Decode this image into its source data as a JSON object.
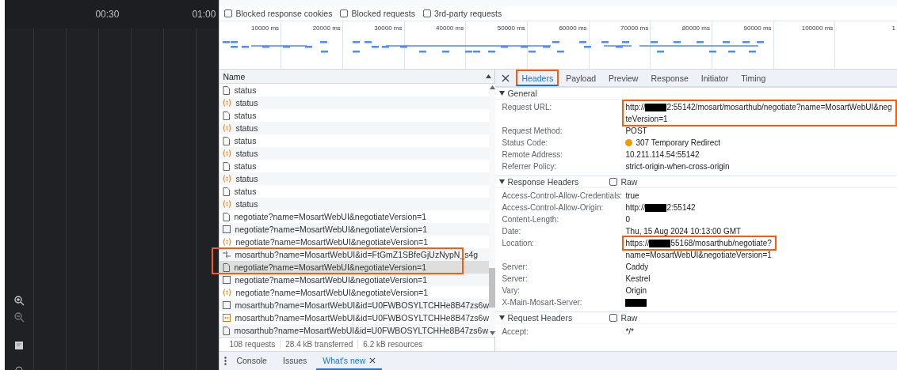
{
  "timeline_panel": {
    "time_labels": [
      "00:30",
      "01:00"
    ]
  },
  "filters": [
    {
      "label": "Blocked response cookies",
      "checked": false
    },
    {
      "label": "Blocked requests",
      "checked": false
    },
    {
      "label": "3rd-party requests",
      "checked": false
    }
  ],
  "overview": {
    "ticks": [
      "10000 ms",
      "20000 ms",
      "30000 ms",
      "40000 ms",
      "50000 ms",
      "60000 ms",
      "70000 ms",
      "80000 ms",
      "90000 ms",
      "100000 ms",
      "1"
    ]
  },
  "requests": {
    "column": "Name",
    "rows": [
      {
        "name": "status",
        "kind": "document",
        "selected": false,
        "highlight": false
      },
      {
        "name": "status",
        "kind": "script",
        "selected": false,
        "highlight": false
      },
      {
        "name": "status",
        "kind": "document",
        "selected": false,
        "highlight": false
      },
      {
        "name": "status",
        "kind": "script",
        "selected": false,
        "highlight": false
      },
      {
        "name": "status",
        "kind": "document",
        "selected": false,
        "highlight": false
      },
      {
        "name": "status",
        "kind": "script",
        "selected": false,
        "highlight": false
      },
      {
        "name": "status",
        "kind": "document",
        "selected": false,
        "highlight": false
      },
      {
        "name": "status",
        "kind": "script",
        "selected": false,
        "highlight": false
      },
      {
        "name": "status",
        "kind": "document",
        "selected": false,
        "highlight": false
      },
      {
        "name": "status",
        "kind": "script",
        "selected": false,
        "highlight": false
      },
      {
        "name": "negotiate?name=MosartWebUI&negotiateVersion=1",
        "kind": "document",
        "selected": false,
        "highlight": false
      },
      {
        "name": "negotiate?name=MosartWebUI&negotiateVersion=1",
        "kind": "fetch",
        "selected": false,
        "highlight": false
      },
      {
        "name": "negotiate?name=MosartWebUI&negotiateVersion=1",
        "kind": "script",
        "selected": false,
        "highlight": false
      },
      {
        "name": "mosarthub?name=MosartWebUI&id=FtGmZ1SBfeGjUzNypN_s4g",
        "kind": "websocket",
        "selected": false,
        "highlight": true
      },
      {
        "name": "negotiate?name=MosartWebUI&negotiateVersion=1",
        "kind": "document",
        "selected": true,
        "highlight": true
      },
      {
        "name": "negotiate?name=MosartWebUI&negotiateVersion=1",
        "kind": "fetch",
        "selected": false,
        "highlight": false
      },
      {
        "name": "negotiate?name=MosartWebUI&negotiateVersion=1",
        "kind": "script",
        "selected": false,
        "highlight": false
      },
      {
        "name": "mosarthub?name=MosartWebUI&id=U0FWBOSYLTCHHe8B47zs6w",
        "kind": "fetch",
        "selected": false,
        "highlight": false
      },
      {
        "name": "mosarthub?name=MosartWebUI&id=U0FWBOSYLTCHHe8B47zs6w",
        "kind": "media",
        "selected": false,
        "highlight": false
      },
      {
        "name": "mosarthub?name=MosartWebUI&id=U0FWBOSYLTCHHe8B47zs6w",
        "kind": "document",
        "selected": false,
        "highlight": false
      }
    ]
  },
  "summary": [
    "108 requests",
    "28.4 kB transferred",
    "6.2 kB resources"
  ],
  "details": {
    "tabs": [
      {
        "label": "Headers",
        "selected": true,
        "highlight": true
      },
      {
        "label": "Payload",
        "selected": false,
        "highlight": false
      },
      {
        "label": "Preview",
        "selected": false,
        "highlight": false
      },
      {
        "label": "Response",
        "selected": false,
        "highlight": false
      },
      {
        "label": "Initiator",
        "selected": false,
        "highlight": false
      },
      {
        "label": "Timing",
        "selected": false,
        "highlight": false
      }
    ],
    "sections": [
      {
        "title": "General",
        "expanded": true,
        "rows": [
          {
            "label": "Request URL:",
            "lines": [
              {
                "highlight": true,
                "segments": [
                  {
                    "kind": "text",
                    "text": "http://"
                  },
                  {
                    "kind": "redacted"
                  },
                  {
                    "kind": "text",
                    "text": "2:55142/mosart/mosarthub/negotiate?name=MosartWebUI&neg"
                  }
                ]
              },
              {
                "highlight": true,
                "segments": [
                  {
                    "kind": "text",
                    "text": "teVersion=1"
                  }
                ]
              }
            ]
          },
          {
            "label": "Request Method:",
            "lines": [
              {
                "highlight": false,
                "segments": [
                  {
                    "kind": "text",
                    "text": "POST"
                  }
                ]
              }
            ]
          },
          {
            "label": "Status Code:",
            "lines": [
              {
                "highlight": false,
                "segments": [
                  {
                    "kind": "dot",
                    "color": "#f29900"
                  },
                  {
                    "kind": "text",
                    "text": "307 Temporary Redirect"
                  }
                ]
              }
            ]
          },
          {
            "label": "Remote Address:",
            "lines": [
              {
                "highlight": false,
                "segments": [
                  {
                    "kind": "text",
                    "text": "10.211.114.54:55142"
                  }
                ]
              }
            ]
          },
          {
            "label": "Referrer Policy:",
            "lines": [
              {
                "highlight": false,
                "segments": [
                  {
                    "kind": "text",
                    "text": "strict-origin-when-cross-origin"
                  }
                ]
              }
            ]
          }
        ]
      },
      {
        "title": "Response Headers",
        "expanded": true,
        "raw": {
          "label": "Raw",
          "checked": false
        },
        "rows": [
          {
            "label": "Access-Control-Allow-Credentials:",
            "lines": [
              {
                "highlight": false,
                "segments": [
                  {
                    "kind": "text",
                    "text": "true"
                  }
                ]
              }
            ]
          },
          {
            "label": "Access-Control-Allow-Origin:",
            "lines": [
              {
                "highlight": false,
                "segments": [
                  {
                    "kind": "text",
                    "text": "http://"
                  },
                  {
                    "kind": "redacted"
                  },
                  {
                    "kind": "text",
                    "text": "2:55142"
                  }
                ]
              }
            ]
          },
          {
            "label": "Content-Length:",
            "lines": [
              {
                "highlight": false,
                "segments": [
                  {
                    "kind": "text",
                    "text": "0"
                  }
                ]
              }
            ]
          },
          {
            "label": "Date:",
            "lines": [
              {
                "highlight": false,
                "segments": [
                  {
                    "kind": "text",
                    "text": "Thu, 15 Aug 2024 10:13:00 GMT"
                  }
                ]
              }
            ]
          },
          {
            "label": "Location:",
            "lines": [
              {
                "highlight": true,
                "segments": [
                  {
                    "kind": "text",
                    "text": "https://"
                  },
                  {
                    "kind": "redacted"
                  },
                  {
                    "kind": "text",
                    "text": "55168/mosarthub/negotiate?"
                  }
                ]
              },
              {
                "highlight": false,
                "segments": [
                  {
                    "kind": "text",
                    "text": "name=MosartWebUI&negotiateVersion=1"
                  }
                ]
              }
            ]
          },
          {
            "label": "Server:",
            "lines": [
              {
                "highlight": false,
                "segments": [
                  {
                    "kind": "text",
                    "text": "Caddy"
                  }
                ]
              }
            ]
          },
          {
            "label": "Server:",
            "lines": [
              {
                "highlight": false,
                "segments": [
                  {
                    "kind": "text",
                    "text": "Kestrel"
                  }
                ]
              }
            ]
          },
          {
            "label": "Vary:",
            "lines": [
              {
                "highlight": false,
                "segments": [
                  {
                    "kind": "text",
                    "text": "Origin"
                  }
                ]
              }
            ]
          },
          {
            "label": "X-Main-Mosart-Server:",
            "lines": [
              {
                "highlight": false,
                "segments": [
                  {
                    "kind": "redacted"
                  }
                ]
              }
            ]
          }
        ]
      },
      {
        "title": "Request Headers",
        "expanded": true,
        "raw": {
          "label": "Raw",
          "checked": false
        },
        "rows": [
          {
            "label": "Accept:",
            "lines": [
              {
                "highlight": false,
                "segments": [
                  {
                    "kind": "text",
                    "text": "*/*"
                  }
                ]
              }
            ]
          }
        ]
      }
    ]
  },
  "drawer": {
    "tabs": [
      {
        "label": "Console",
        "selected": false,
        "closable": false
      },
      {
        "label": "Issues",
        "selected": false,
        "closable": false
      },
      {
        "label": "What's new",
        "selected": true,
        "closable": true
      }
    ]
  }
}
